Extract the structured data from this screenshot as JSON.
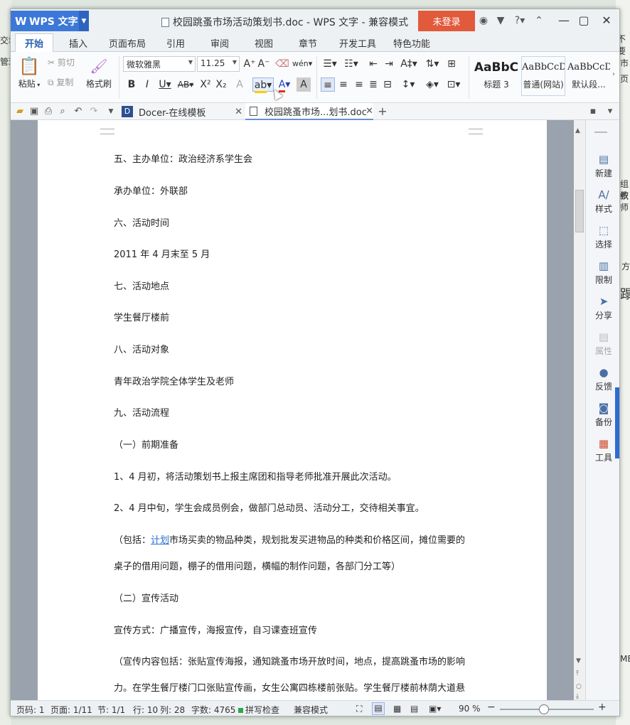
{
  "background": {
    "left_fragments": [
      "交域",
      "管理"
    ],
    "right_fragments": [
      "不要",
      "市",
      "页",
      "组织",
      "教师",
      "方",
      "蹋",
      "MB"
    ]
  },
  "titlebar": {
    "app_button": "WPS 文字",
    "title": "校园跳蚤市场活动策划书.doc - WPS 文字 - 兼容模式",
    "login": "未登录"
  },
  "menu_tabs": [
    "开始",
    "插入",
    "页面布局",
    "引用",
    "审阅",
    "视图",
    "章节",
    "开发工具",
    "特色功能"
  ],
  "ribbon": {
    "paste": "粘贴",
    "cut": "剪切",
    "copy": "复制",
    "format_painter": "格式刷",
    "font_name": "微软雅黑",
    "font_size": "11.25",
    "styles": [
      {
        "sample": "AaBbC",
        "name": "标题 3"
      },
      {
        "sample": "AaBbCcD",
        "name": "普通(网站)"
      },
      {
        "sample": "AaBbCcDd",
        "name": "默认段..."
      }
    ]
  },
  "doc_tabs": [
    {
      "label": "Docer-在线模板"
    },
    {
      "label": "校园跳蚤市场...划书.doc"
    }
  ],
  "document": {
    "paragraphs": [
      "五、主办单位：政治经济系学生会",
      "承办单位：外联部",
      "六、活动时间",
      "2011 年 4 月末至 5 月",
      "七、活动地点",
      "学生餐厅楼前",
      "八、活动对象",
      "青年政治学院全体学生及老师",
      "九、活动流程",
      "（一）前期准备",
      "1、4 月初，将活动策划书上报主席团和指导老师批准开展此次活动。",
      "2、4 月中旬，学生会成员例会，做部门总动员、活动分工，交待相关事宜。"
    ],
    "p13_prefix": "（包括：",
    "p13_link": "计划",
    "p13_suffix": "市场买卖的物品种类，规划批发买进物品的种类和价格区间，摊位需要的",
    "p14": "桌子的借用问题，棚子的借用问题，横幅的制作问题，各部门分工等）",
    "p15": "（二）宣传活动",
    "p16": "宣传方式：广播宣传，海报宣传，自习课查班宣传",
    "p17": "（宣传内容包括：张贴宣传海报，通知跳蚤市场开放时间，地点，提高跳蚤市场的影响",
    "p18": "力。在学生餐厅楼门口张贴宣传画，女生公寓四栋楼前张贴。学生餐厅楼前林荫大道悬"
  },
  "side_panel": [
    "新建",
    "样式",
    "选择",
    "限制",
    "分享",
    "属性",
    "反馈",
    "备份",
    "工具"
  ],
  "statusbar": {
    "page_num": "页码: 1",
    "pages": "页面: 1/11",
    "section": "节: 1/1",
    "row": "行: 10",
    "col": "列: 28",
    "words": "字数: 4765",
    "spell": "拼写检查",
    "mode": "兼容模式",
    "zoom": "90 %"
  },
  "zoom_level": 0.9
}
